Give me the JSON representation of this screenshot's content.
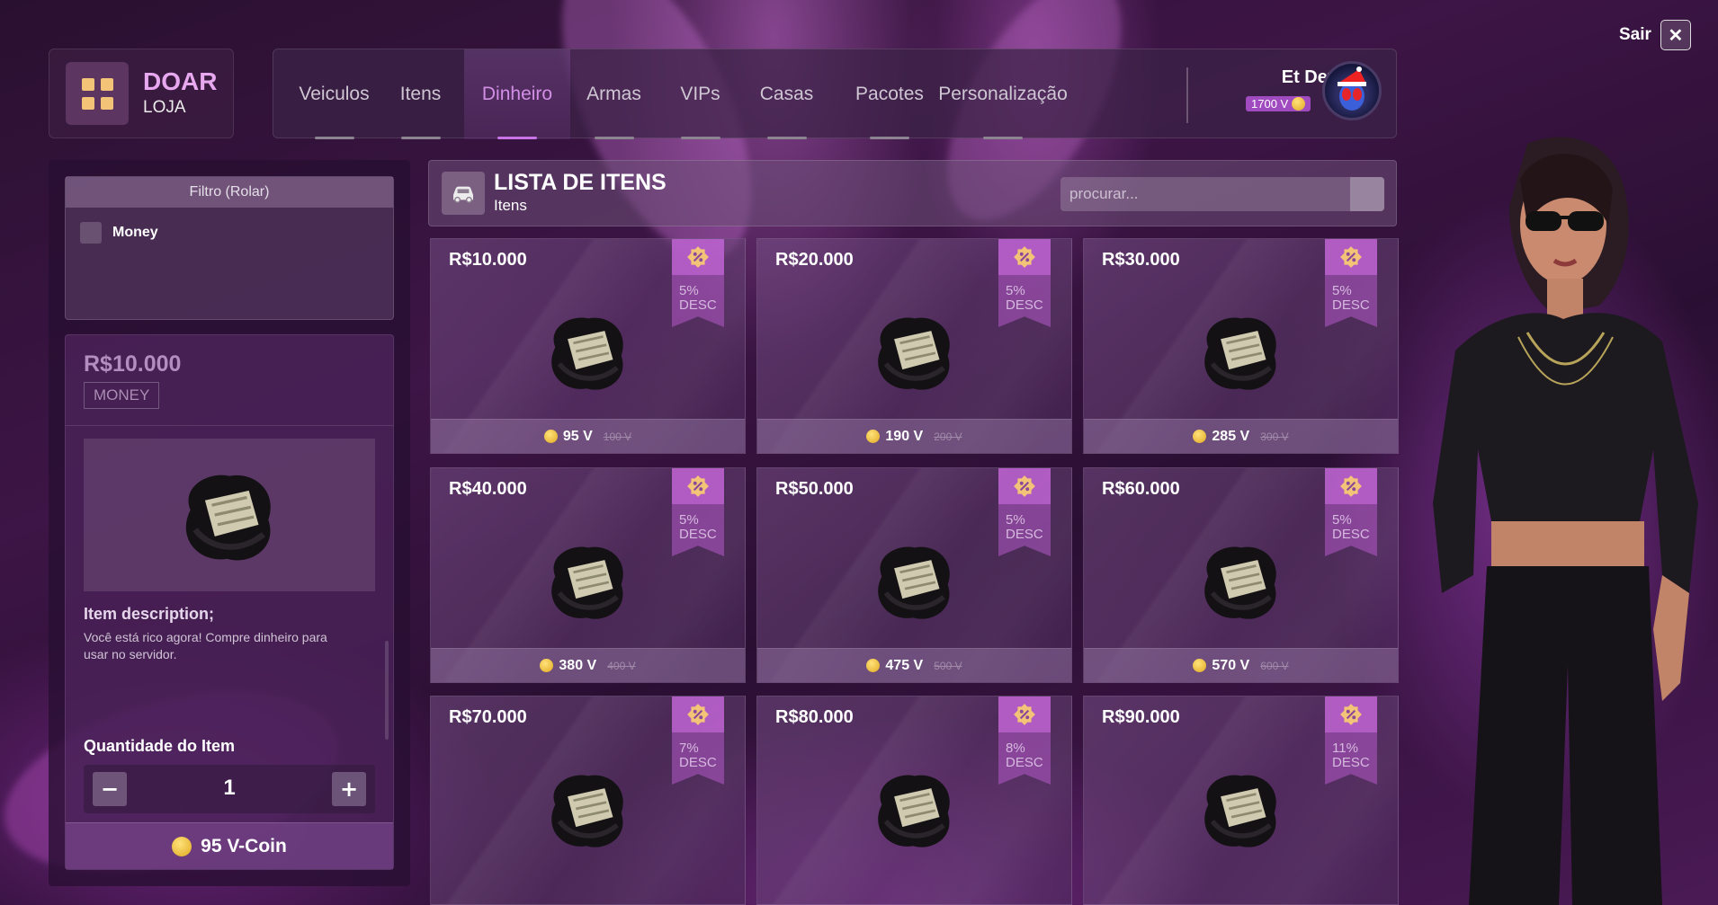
{
  "brand": {
    "title": "DOAR",
    "subtitle": "LOJA"
  },
  "nav": {
    "tabs": [
      {
        "label": "Veiculos"
      },
      {
        "label": "Itens"
      },
      {
        "label": "Dinheiro"
      },
      {
        "label": "Armas"
      },
      {
        "label": "VIPs"
      },
      {
        "label": "Casas"
      },
      {
        "label": "Pacotes"
      },
      {
        "label": "Personalização"
      }
    ],
    "active_tab": "Dinheiro"
  },
  "user": {
    "name": "Et Dev",
    "balance": "1700 V"
  },
  "exit": {
    "label": "Sair",
    "icon": "close-icon"
  },
  "filter": {
    "title": "Filtro (Rolar)",
    "items": [
      {
        "label": "Money",
        "checked": false
      }
    ]
  },
  "detail": {
    "name": "R$10.000",
    "category": "MONEY",
    "desc_title": "Item description;",
    "desc_text": "Você está rico agora! Compre dinheiro para usar no servidor.",
    "qty_label": "Quantidade do Item",
    "quantity": "1",
    "buy_label": "95 V-Coin"
  },
  "list": {
    "title": "LISTA DE ITENS",
    "subtitle": "Itens",
    "search_placeholder": "procurar..."
  },
  "items": [
    {
      "name": "R$10.000",
      "discount": "5%",
      "desc": "DESC",
      "price": "95 V",
      "old": "100 V"
    },
    {
      "name": "R$20.000",
      "discount": "5%",
      "desc": "DESC",
      "price": "190 V",
      "old": "200 V"
    },
    {
      "name": "R$30.000",
      "discount": "5%",
      "desc": "DESC",
      "price": "285 V",
      "old": "300 V"
    },
    {
      "name": "R$40.000",
      "discount": "5%",
      "desc": "DESC",
      "price": "380 V",
      "old": "400 V"
    },
    {
      "name": "R$50.000",
      "discount": "5%",
      "desc": "DESC",
      "price": "475 V",
      "old": "500 V"
    },
    {
      "name": "R$60.000",
      "discount": "5%",
      "desc": "DESC",
      "price": "570 V",
      "old": "600 V"
    },
    {
      "name": "R$70.000",
      "discount": "7%",
      "desc": "DESC",
      "price": "",
      "old": ""
    },
    {
      "name": "R$80.000",
      "discount": "8%",
      "desc": "DESC",
      "price": "",
      "old": ""
    },
    {
      "name": "R$90.000",
      "discount": "11%",
      "desc": "DESC",
      "price": "",
      "old": ""
    }
  ],
  "colors": {
    "accent": "#c974e6",
    "brand": "#e7a8ef",
    "coin": "#f3c230",
    "logo_tile": "#f3c477"
  }
}
